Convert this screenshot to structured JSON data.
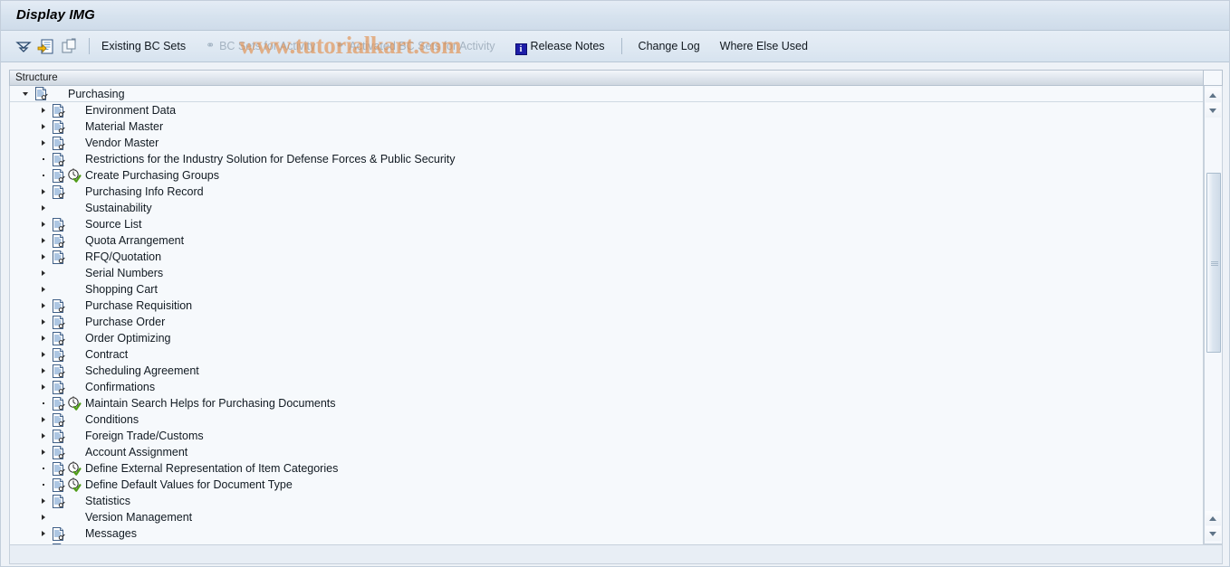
{
  "window": {
    "title": "Display IMG"
  },
  "toolbar": {
    "icons": [
      {
        "name": "expand-collapse-icon",
        "title": "Expand/Collapse"
      },
      {
        "name": "display-documentation-icon",
        "title": "Display Documentation"
      },
      {
        "name": "copy-structure-icon",
        "title": "Where-Used / Copy"
      }
    ],
    "buttons": [
      {
        "label": "Existing BC Sets",
        "disabled": false,
        "glyph": ""
      },
      {
        "label": "BC Sets for Activity",
        "disabled": true,
        "glyph": "bc-set-glasses-icon"
      },
      {
        "label": "Activated BC Sets for Activity",
        "disabled": true,
        "glyph": "bc-set-glasses-icon"
      },
      {
        "label": "Release Notes",
        "disabled": false,
        "glyph": "info-icon"
      },
      {
        "label": "Change Log",
        "disabled": false,
        "glyph": ""
      },
      {
        "label": "Where Else Used",
        "disabled": false,
        "glyph": ""
      }
    ]
  },
  "watermark": {
    "text": "www.tutorialkart.com",
    "color": "#e28a46"
  },
  "structure": {
    "column_header": "Structure",
    "rows": [
      {
        "label": "Purchasing",
        "indent": 0,
        "state": "open",
        "doc": true,
        "action": false
      },
      {
        "label": "Environment Data",
        "indent": 1,
        "state": "closed",
        "doc": true,
        "action": false
      },
      {
        "label": "Material Master",
        "indent": 1,
        "state": "closed",
        "doc": true,
        "action": false
      },
      {
        "label": "Vendor Master",
        "indent": 1,
        "state": "closed",
        "doc": true,
        "action": false
      },
      {
        "label": "Restrictions for the Industry Solution for Defense Forces & Public Security",
        "indent": 1,
        "state": "leaf",
        "doc": true,
        "action": false
      },
      {
        "label": "Create Purchasing Groups",
        "indent": 1,
        "state": "leaf",
        "doc": true,
        "action": true
      },
      {
        "label": "Purchasing Info Record",
        "indent": 1,
        "state": "closed",
        "doc": true,
        "action": false
      },
      {
        "label": "Sustainability",
        "indent": 1,
        "state": "closed",
        "doc": false,
        "action": false
      },
      {
        "label": "Source List",
        "indent": 1,
        "state": "closed",
        "doc": true,
        "action": false
      },
      {
        "label": "Quota Arrangement",
        "indent": 1,
        "state": "closed",
        "doc": true,
        "action": false
      },
      {
        "label": "RFQ/Quotation",
        "indent": 1,
        "state": "closed",
        "doc": true,
        "action": false
      },
      {
        "label": "Serial Numbers",
        "indent": 1,
        "state": "closed",
        "doc": false,
        "action": false
      },
      {
        "label": "Shopping Cart",
        "indent": 1,
        "state": "closed",
        "doc": false,
        "action": false
      },
      {
        "label": "Purchase Requisition",
        "indent": 1,
        "state": "closed",
        "doc": true,
        "action": false
      },
      {
        "label": "Purchase Order",
        "indent": 1,
        "state": "closed",
        "doc": true,
        "action": false
      },
      {
        "label": "Order Optimizing",
        "indent": 1,
        "state": "closed",
        "doc": true,
        "action": false
      },
      {
        "label": "Contract",
        "indent": 1,
        "state": "closed",
        "doc": true,
        "action": false
      },
      {
        "label": "Scheduling Agreement",
        "indent": 1,
        "state": "closed",
        "doc": true,
        "action": false
      },
      {
        "label": "Confirmations",
        "indent": 1,
        "state": "closed",
        "doc": true,
        "action": false
      },
      {
        "label": "Maintain Search Helps for Purchasing Documents",
        "indent": 1,
        "state": "leaf",
        "doc": true,
        "action": true
      },
      {
        "label": "Conditions",
        "indent": 1,
        "state": "closed",
        "doc": true,
        "action": false
      },
      {
        "label": "Foreign Trade/Customs",
        "indent": 1,
        "state": "closed",
        "doc": true,
        "action": false
      },
      {
        "label": "Account Assignment",
        "indent": 1,
        "state": "closed",
        "doc": true,
        "action": false
      },
      {
        "label": "Define External Representation of Item Categories",
        "indent": 1,
        "state": "leaf",
        "doc": true,
        "action": true
      },
      {
        "label": "Define Default Values for Document Type",
        "indent": 1,
        "state": "leaf",
        "doc": true,
        "action": true
      },
      {
        "label": "Statistics",
        "indent": 1,
        "state": "closed",
        "doc": true,
        "action": false
      },
      {
        "label": "Version Management",
        "indent": 1,
        "state": "closed",
        "doc": false,
        "action": false
      },
      {
        "label": "Messages",
        "indent": 1,
        "state": "closed",
        "doc": true,
        "action": false
      },
      {
        "label": "",
        "indent": 1,
        "state": "closed",
        "doc": true,
        "action": false
      }
    ]
  },
  "scrollbar": {
    "up_arrow": "scroll-up-arrow",
    "down_arrow": "scroll-down-arrow",
    "thumb_top_pct": 14,
    "thumb_height_pct": 46
  }
}
